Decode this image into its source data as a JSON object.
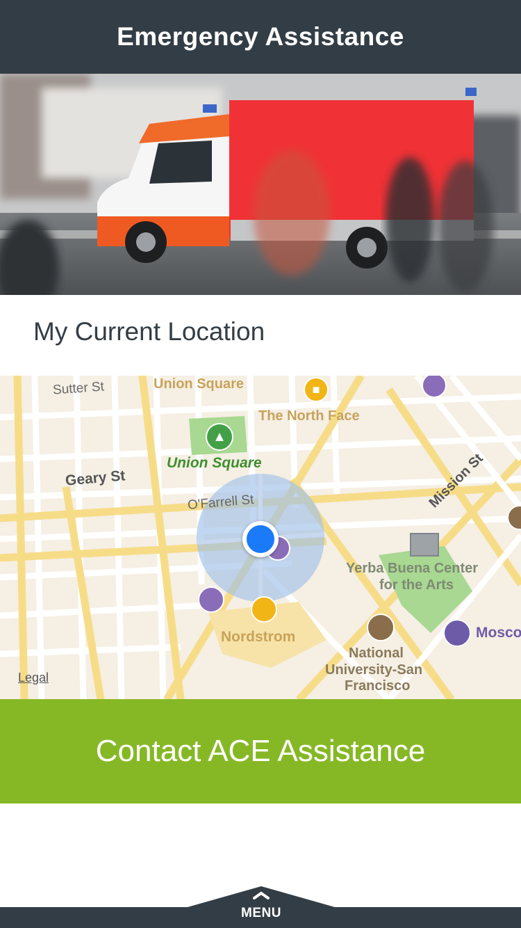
{
  "header": {
    "title": "Emergency Assistance"
  },
  "hero": {
    "image_desc_icon": "ambulance-photo"
  },
  "location": {
    "label": "My Current Location"
  },
  "map": {
    "streets": {
      "sutter": "Sutter St",
      "geary": "Geary St",
      "ofarrell": "O'Farrell St",
      "mission": "Mission St"
    },
    "places": {
      "union_square_top": "Union Square",
      "north_face": "The North Face",
      "union_square_park": "Union Square",
      "nordstrom": "Nordstrom",
      "yerba_buena_1": "Yerba Buena Center",
      "yerba_buena_2": "for the Arts",
      "national_1": "National",
      "national_2": "University-San",
      "national_3": "Francisco",
      "moscone": "Mosco"
    },
    "legal": "Legal"
  },
  "cta": {
    "label": "Contact ACE Assistance"
  },
  "footer": {
    "menu_label": "MENU"
  },
  "colors": {
    "header_bg": "#333d45",
    "cta_bg": "#86b826",
    "user_dot": "#1a7af8",
    "accuracy_circle": "#9fc0e8"
  }
}
